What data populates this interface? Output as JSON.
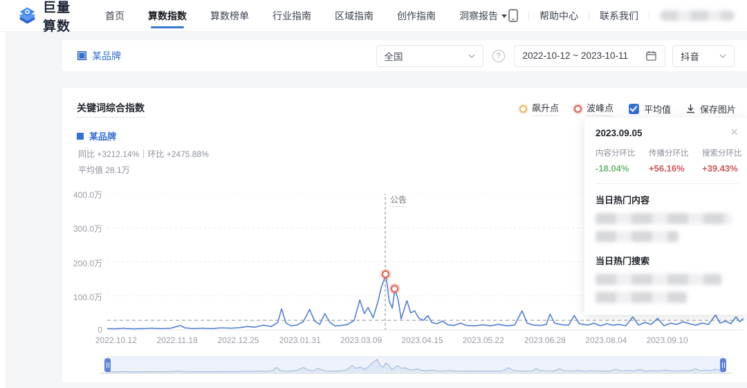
{
  "brand": {
    "name": "巨量算数"
  },
  "nav": {
    "items": [
      {
        "key": "home",
        "label": "首页",
        "active": false,
        "dropdown": false
      },
      {
        "key": "index",
        "label": "算数指数",
        "active": true,
        "dropdown": false
      },
      {
        "key": "rankings",
        "label": "算数榜单",
        "active": false,
        "dropdown": false
      },
      {
        "key": "industry-guide",
        "label": "行业指南",
        "active": false,
        "dropdown": false
      },
      {
        "key": "region-guide",
        "label": "区域指南",
        "active": false,
        "dropdown": false
      },
      {
        "key": "creation-guide",
        "label": "创作指南",
        "active": false,
        "dropdown": false
      },
      {
        "key": "insight-reports",
        "label": "洞察报告",
        "active": false,
        "dropdown": true
      }
    ],
    "help": "帮助中心",
    "contact": "联系我们"
  },
  "filter": {
    "keyword": "某品牌",
    "region": "全国",
    "date_range": "2022-10-12 ~ 2023-10-11",
    "platform": "抖音"
  },
  "chart": {
    "title": "关键词综合指数",
    "legend": {
      "surge": "飙升点",
      "peak": "波峰点",
      "average": "平均值",
      "average_checked": true,
      "save": "保存图片"
    },
    "series_info": {
      "name": "某品牌",
      "stats": "同比 +3212.14%｜环比 +2475.88%",
      "average": "平均值 28.1万"
    }
  },
  "chart_data": {
    "type": "line",
    "title": "关键词综合指数",
    "unit": "万",
    "ylim": [
      0,
      400
    ],
    "y_ticks": [
      "400.0万",
      "300.0万",
      "200.0万",
      "100.0万",
      "0"
    ],
    "x_ticks": [
      {
        "label": "2022.10.12",
        "t": 0.014
      },
      {
        "label": "2022.11.18",
        "t": 0.11
      },
      {
        "label": "2022.12.25",
        "t": 0.206
      },
      {
        "label": "2023.01.31",
        "t": 0.303
      },
      {
        "label": "2023.03.09",
        "t": 0.399
      },
      {
        "label": "2023.04.15",
        "t": 0.495
      },
      {
        "label": "2023.05.22",
        "t": 0.591
      },
      {
        "label": "2023.06.28",
        "t": 0.688
      },
      {
        "label": "2023.08.04",
        "t": 0.784
      },
      {
        "label": "2023.09.10",
        "t": 0.88
      }
    ],
    "average_value": 28.1,
    "yoy": "+3212.14%",
    "mom": "+2475.88%",
    "annotation": {
      "label": "公告",
      "t": 0.437
    },
    "markers": [
      {
        "type": "波峰点",
        "t": 0.438,
        "value": 162
      },
      {
        "type": "波峰点",
        "t": 0.452,
        "value": 119
      }
    ],
    "series": [
      {
        "name": "某品牌",
        "points": [
          [
            0,
            4
          ],
          [
            0.012,
            3
          ],
          [
            0.025,
            5
          ],
          [
            0.04,
            3
          ],
          [
            0.055,
            4
          ],
          [
            0.07,
            5
          ],
          [
            0.085,
            4
          ],
          [
            0.1,
            5
          ],
          [
            0.115,
            13
          ],
          [
            0.122,
            6
          ],
          [
            0.135,
            4
          ],
          [
            0.15,
            5
          ],
          [
            0.165,
            4
          ],
          [
            0.18,
            6
          ],
          [
            0.195,
            5
          ],
          [
            0.21,
            7
          ],
          [
            0.22,
            10
          ],
          [
            0.232,
            8
          ],
          [
            0.245,
            14
          ],
          [
            0.258,
            10
          ],
          [
            0.268,
            22
          ],
          [
            0.274,
            62
          ],
          [
            0.281,
            20
          ],
          [
            0.289,
            12
          ],
          [
            0.298,
            14
          ],
          [
            0.308,
            24
          ],
          [
            0.318,
            60
          ],
          [
            0.326,
            26
          ],
          [
            0.334,
            16
          ],
          [
            0.342,
            48
          ],
          [
            0.35,
            22
          ],
          [
            0.358,
            12
          ],
          [
            0.368,
            13
          ],
          [
            0.378,
            16
          ],
          [
            0.388,
            28
          ],
          [
            0.397,
            88
          ],
          [
            0.404,
            48
          ],
          [
            0.41,
            66
          ],
          [
            0.418,
            36
          ],
          [
            0.425,
            80
          ],
          [
            0.431,
            126
          ],
          [
            0.438,
            162
          ],
          [
            0.443,
            85
          ],
          [
            0.448,
            64
          ],
          [
            0.452,
            119
          ],
          [
            0.457,
            92
          ],
          [
            0.462,
            32
          ],
          [
            0.471,
            86
          ],
          [
            0.477,
            50
          ],
          [
            0.483,
            56
          ],
          [
            0.49,
            34
          ],
          [
            0.497,
            28
          ],
          [
            0.504,
            42
          ],
          [
            0.51,
            22
          ],
          [
            0.518,
            18
          ],
          [
            0.527,
            26
          ],
          [
            0.535,
            15
          ],
          [
            0.545,
            13
          ],
          [
            0.555,
            20
          ],
          [
            0.565,
            13
          ],
          [
            0.578,
            12
          ],
          [
            0.59,
            15
          ],
          [
            0.602,
            12
          ],
          [
            0.615,
            16
          ],
          [
            0.628,
            12
          ],
          [
            0.64,
            14
          ],
          [
            0.652,
            56
          ],
          [
            0.66,
            20
          ],
          [
            0.67,
            14
          ],
          [
            0.68,
            13
          ],
          [
            0.69,
            16
          ],
          [
            0.696,
            46
          ],
          [
            0.703,
            20
          ],
          [
            0.715,
            15
          ],
          [
            0.725,
            14
          ],
          [
            0.734,
            42
          ],
          [
            0.742,
            18
          ],
          [
            0.755,
            14
          ],
          [
            0.765,
            20
          ],
          [
            0.775,
            12
          ],
          [
            0.785,
            18
          ],
          [
            0.795,
            14
          ],
          [
            0.805,
            16
          ],
          [
            0.815,
            12
          ],
          [
            0.826,
            38
          ],
          [
            0.835,
            14
          ],
          [
            0.845,
            22
          ],
          [
            0.855,
            16
          ],
          [
            0.865,
            34
          ],
          [
            0.875,
            12
          ],
          [
            0.885,
            20
          ],
          [
            0.895,
            16
          ],
          [
            0.905,
            24
          ],
          [
            0.915,
            18
          ],
          [
            0.925,
            14
          ],
          [
            0.935,
            20
          ],
          [
            0.945,
            16
          ],
          [
            0.956,
            44
          ],
          [
            0.963,
            20
          ],
          [
            0.972,
            26
          ],
          [
            0.98,
            18
          ],
          [
            0.988,
            38
          ],
          [
            0.994,
            24
          ],
          [
            1,
            34
          ]
        ]
      }
    ]
  },
  "tooltip": {
    "date": "2023.09.05",
    "metrics": [
      {
        "label": "内容分环比",
        "value": "-18.04%",
        "color": "#6cba74"
      },
      {
        "label": "传播分环比",
        "value": "+56.16%",
        "color": "#cf5659"
      },
      {
        "label": "搜索分环比",
        "value": "+39.43%",
        "color": "#cf5659"
      }
    ],
    "hot_content_title": "当日热门内容",
    "hot_search_title": "当日热门搜索",
    "hot_content_redacted_widths": [
      95,
      58
    ],
    "hot_search_redacted_widths": [
      88,
      64
    ]
  },
  "colors": {
    "accent": "#3370d4",
    "line": "#4e7fd6",
    "surge_marker": "#e9b96a",
    "peak_marker": "#e2604e",
    "grid": "#e8eaef",
    "average_line": "#8b919b"
  }
}
